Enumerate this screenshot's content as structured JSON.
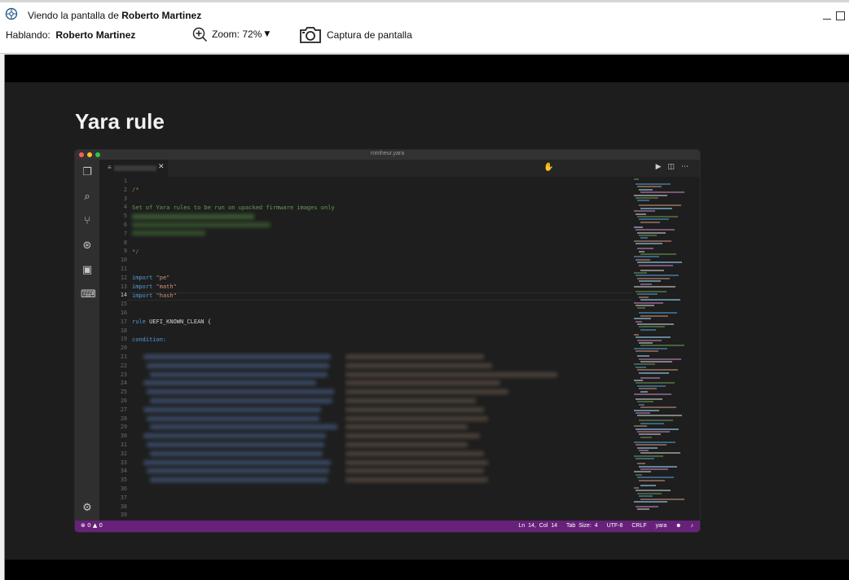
{
  "window": {
    "title_prefix": "Viendo la pantalla de ",
    "title_name": "Roberto Martinez"
  },
  "toolbar": {
    "talking_label": "Hablando:",
    "talking_name": "Roberto Martinez",
    "zoom_label": "Zoom: 72%",
    "capture_label": "Captura de pantalla"
  },
  "slide": {
    "title": "Yara rule"
  },
  "editor": {
    "filename": "romheur.yara",
    "line_numbers": [
      "1",
      "2",
      "3",
      "4",
      "5",
      "6",
      "7",
      "8",
      "9",
      "10",
      "11",
      "12",
      "13",
      "14",
      "15",
      "16",
      "17",
      "18",
      "19",
      "20",
      "21",
      "22",
      "23",
      "24",
      "25",
      "26",
      "27",
      "28",
      "29",
      "30",
      "31",
      "32",
      "33",
      "34",
      "35",
      "36",
      "37",
      "38",
      "39"
    ],
    "code": {
      "l2": "/*",
      "l4": "Set of Yara rules to be run on upacked firmware images only",
      "l9": "*/",
      "l12_kw": "import",
      "l12_str": "\"pe\"",
      "l13_kw": "import",
      "l13_str": "\"math\"",
      "l14_kw": "import",
      "l14_str": "\"hash\"",
      "l17_kw": "rule",
      "l17_name": "UEFI_KNOWN_CLEAN {",
      "l19_kw": "condition:"
    },
    "status": {
      "errors": "0",
      "warnings": "0",
      "position": "Ln 14, Col 14",
      "tab_size": "Tab Size: 4",
      "encoding": "UTF-8",
      "eol": "CRLF",
      "language": "yara"
    }
  }
}
